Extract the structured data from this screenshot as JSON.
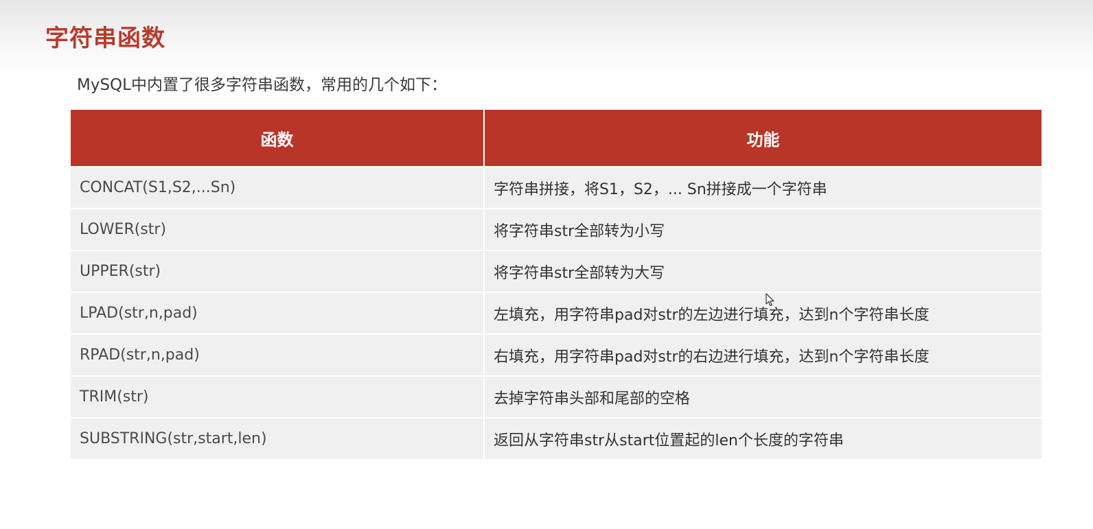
{
  "page": {
    "title": "字符串函数",
    "intro": "MySQL中内置了很多字符串函数，常用的几个如下："
  },
  "table": {
    "headers": {
      "function": "函数",
      "description": "功能"
    },
    "rows": [
      {
        "function": "CONCAT(S1,S2,...Sn)",
        "description": "字符串拼接，将S1，S2，... Sn拼接成一个字符串"
      },
      {
        "function": "LOWER(str)",
        "description": "将字符串str全部转为小写"
      },
      {
        "function": "UPPER(str)",
        "description": "将字符串str全部转为大写"
      },
      {
        "function": "LPAD(str,n,pad)",
        "description": "左填充，用字符串pad对str的左边进行填充，达到n个字符串长度"
      },
      {
        "function": "RPAD(str,n,pad)",
        "description": "右填充，用字符串pad对str的右边进行填充，达到n个字符串长度"
      },
      {
        "function": "TRIM(str)",
        "description": "去掉字符串头部和尾部的空格"
      },
      {
        "function": "SUBSTRING(str,start,len)",
        "description": "返回从字符串str从start位置起的len个长度的字符串"
      }
    ]
  },
  "colors": {
    "title": "#b83b2b",
    "header_background": "#b83528",
    "row_background": "#f0f0f0"
  },
  "icons": {
    "cursor": "mouse-pointer-icon"
  }
}
